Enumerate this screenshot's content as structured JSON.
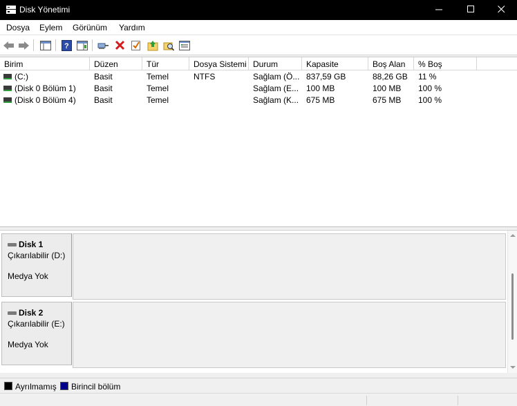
{
  "window": {
    "title": "Disk Yönetimi",
    "colors": {
      "titlebar_bg": "#000000",
      "selection": "#0a246a"
    }
  },
  "menu": {
    "items": [
      "Dosya",
      "Eylem",
      "Görünüm",
      "Yardım"
    ]
  },
  "toolbar": {
    "icons": [
      "back-arrow-icon",
      "forward-arrow-icon",
      "show-hide-console-tree-icon",
      "help-icon",
      "show-hide-action-pane-icon",
      "connect-icon",
      "delete-icon",
      "properties-check-icon",
      "folder-up-icon",
      "search-folder-icon",
      "list-view-icon"
    ]
  },
  "volumes": {
    "columns": [
      "Birim",
      "Düzen",
      "Tür",
      "Dosya Sistemi",
      "Durum",
      "Kapasite",
      "Boş Alan",
      "% Boş"
    ],
    "rows": [
      {
        "birim": " (C:)",
        "duzen": "Basit",
        "tur": "Temel",
        "dosya_sistemi": "NTFS",
        "durum": "Sağlam (Ö...",
        "kapasite": "837,59 GB",
        "bos_alan": "88,26 GB",
        "yuzde_bos": "11 %"
      },
      {
        "birim": "(Disk 0 Bölüm 1)",
        "duzen": "Basit",
        "tur": "Temel",
        "dosya_sistemi": "",
        "durum": "Sağlam (E...",
        "kapasite": "100 MB",
        "bos_alan": "100 MB",
        "yuzde_bos": "100 %"
      },
      {
        "birim": "(Disk 0 Bölüm 4)",
        "duzen": "Basit",
        "tur": "Temel",
        "dosya_sistemi": "",
        "durum": "Sağlam (K...",
        "kapasite": "675 MB",
        "bos_alan": "675 MB",
        "yuzde_bos": "100 %"
      }
    ]
  },
  "disks": [
    {
      "name": "Disk 1",
      "type": "Çıkarılabilir (D:)",
      "media": "Medya Yok"
    },
    {
      "name": "Disk 2",
      "type": "Çıkarılabilir (E:)",
      "media": "Medya Yok"
    }
  ],
  "legend": {
    "items": [
      {
        "label": "Ayrılmamış",
        "color": "#000000"
      },
      {
        "label": "Birincil bölüm",
        "color": "#00008b"
      }
    ]
  }
}
